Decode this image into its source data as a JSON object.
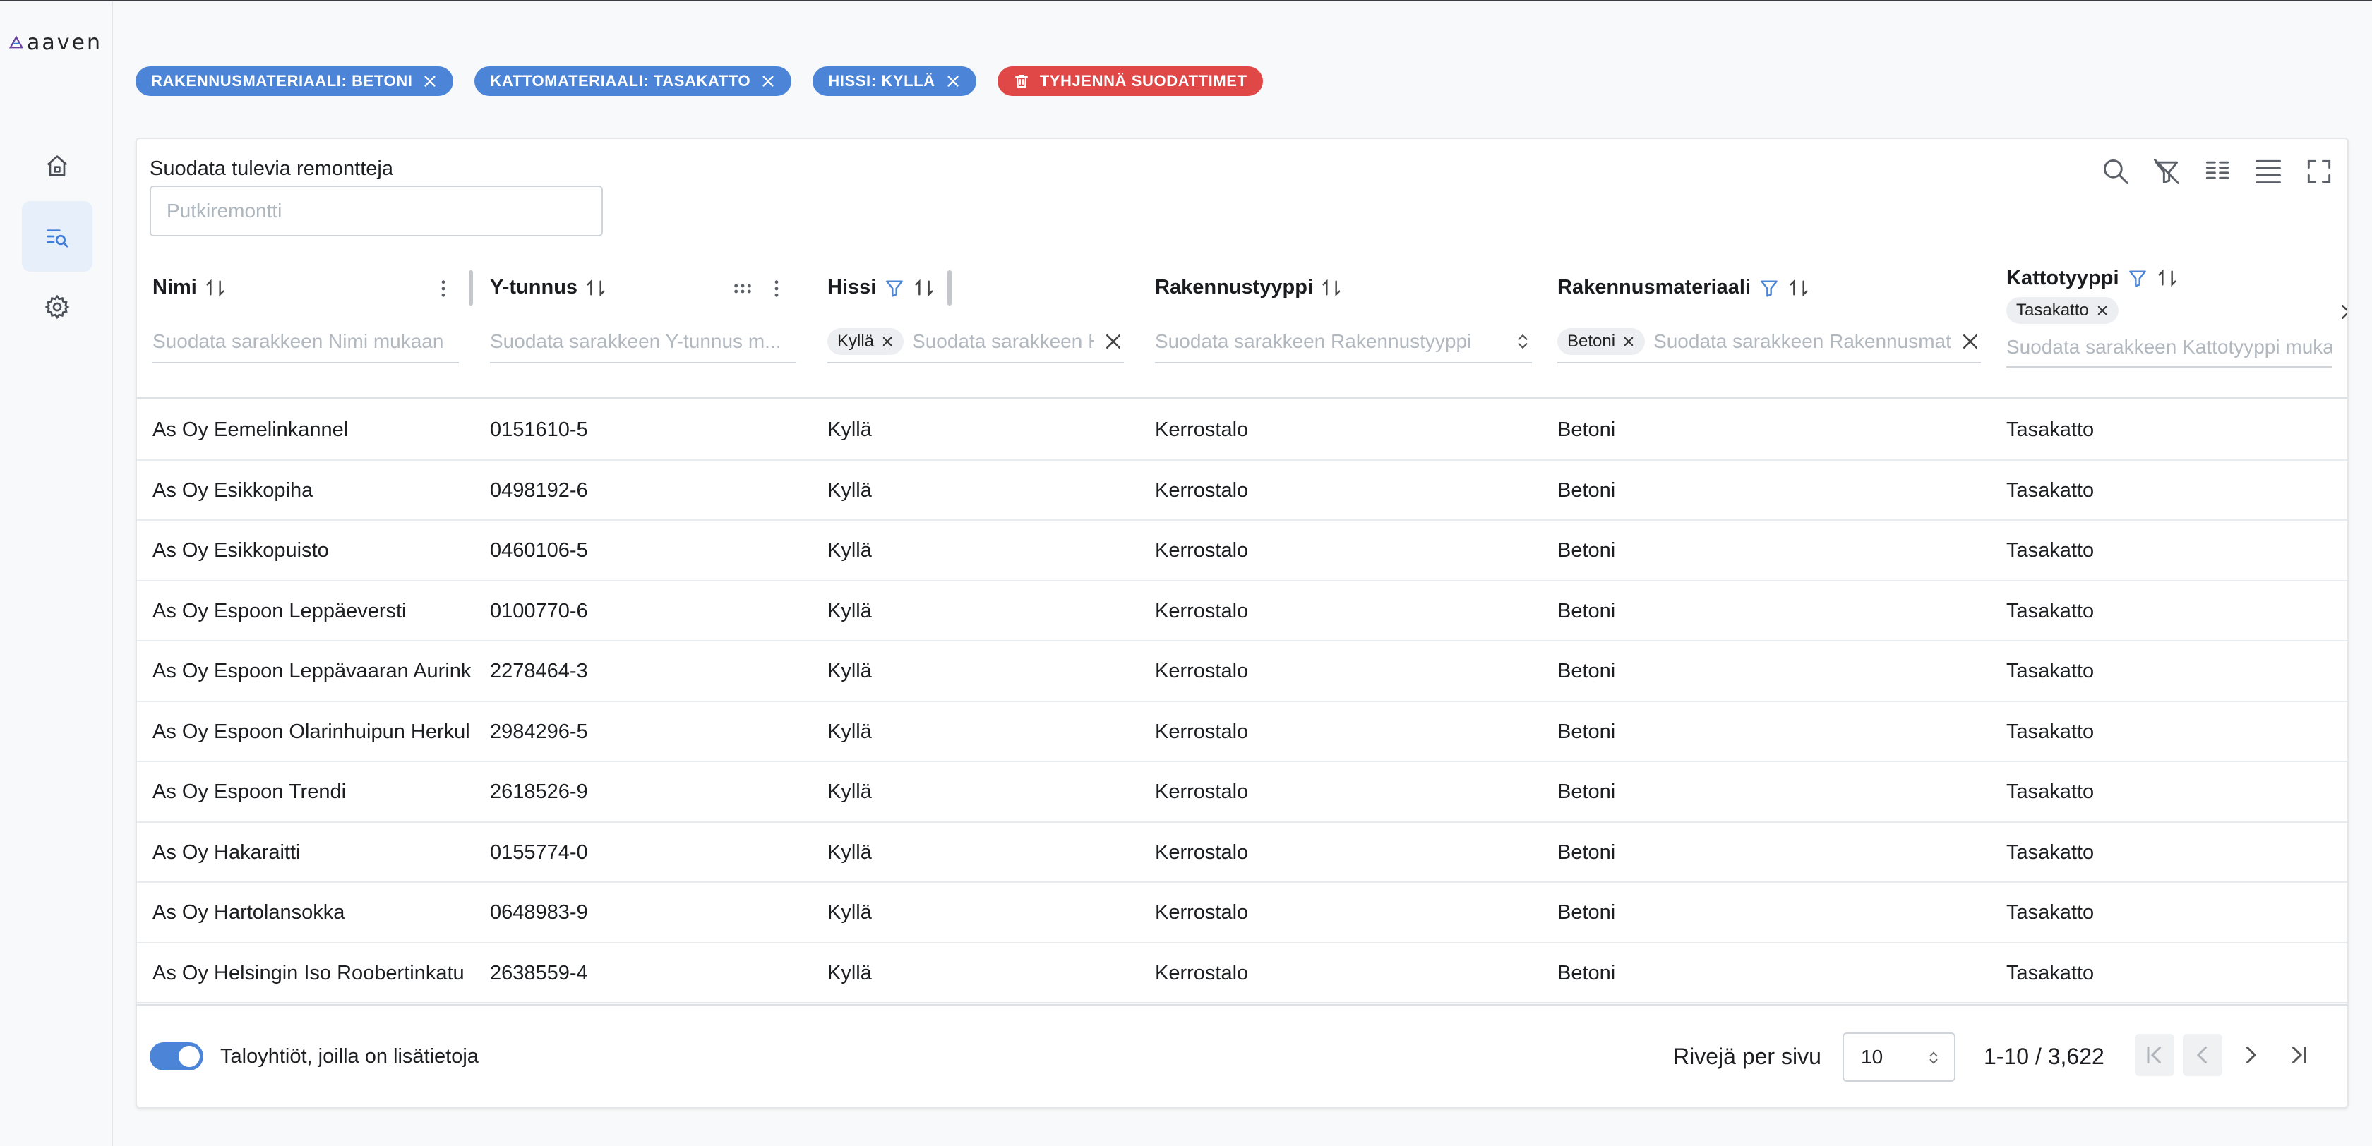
{
  "app": {
    "logo_text": "aaven"
  },
  "sidebar": {
    "items": [
      {
        "icon": "home-icon"
      },
      {
        "icon": "search-list-icon",
        "active": true
      },
      {
        "icon": "gear-icon"
      }
    ]
  },
  "active_filters": {
    "chips": [
      {
        "label": "RAKENNUSMATERIAALI: BETONI"
      },
      {
        "label": "KATTOMATERIAALI: TASAKATTO"
      },
      {
        "label": "HISSI: KYLLÄ"
      }
    ],
    "clear_label": "TYHJENNÄ SUODATTIMET"
  },
  "table": {
    "global_filter": {
      "label": "Suodata tulevia remontteja",
      "placeholder": "Putkiremontti",
      "value": ""
    },
    "columns": [
      {
        "key": "nimi",
        "title": "Nimi",
        "filter_placeholder": "Suodata sarakkeen Nimi mukaan"
      },
      {
        "key": "ytunnus",
        "title": "Y-tunnus",
        "filter_placeholder": "Suodata sarakkeen Y-tunnus m..."
      },
      {
        "key": "hissi",
        "title": "Hissi",
        "filter_chip": "Kyllä",
        "filter_placeholder": "Suodata sarakkeen Hissi mukaan"
      },
      {
        "key": "rakennustyyppi",
        "title": "Rakennustyyppi",
        "filter_placeholder": "Suodata sarakkeen Rakennustyyppi"
      },
      {
        "key": "rakennusmateriaali",
        "title": "Rakennusmateriaali",
        "filter_chip": "Betoni",
        "filter_placeholder": "Suodata sarakkeen Rakennusmateriaali mukaan"
      },
      {
        "key": "kattotyyppi",
        "title": "Kattotyyppi",
        "filter_chip": "Tasakatto",
        "filter_placeholder": "Suodata sarakkeen Kattotyyppi mukaan"
      }
    ],
    "rows": [
      [
        "As Oy Eemelinkannel",
        "0151610-5",
        "Kyllä",
        "Kerrostalo",
        "Betoni",
        "Tasakatto"
      ],
      [
        "As Oy Esikkopiha",
        "0498192-6",
        "Kyllä",
        "Kerrostalo",
        "Betoni",
        "Tasakatto"
      ],
      [
        "As Oy Esikkopuisto",
        "0460106-5",
        "Kyllä",
        "Kerrostalo",
        "Betoni",
        "Tasakatto"
      ],
      [
        "As Oy Espoon Leppäeversti",
        "0100770-6",
        "Kyllä",
        "Kerrostalo",
        "Betoni",
        "Tasakatto"
      ],
      [
        "As Oy Espoon Leppävaaran Aurink",
        "2278464-3",
        "Kyllä",
        "Kerrostalo",
        "Betoni",
        "Tasakatto"
      ],
      [
        "As Oy Espoon Olarinhuipun Herkul",
        "2984296-5",
        "Kyllä",
        "Kerrostalo",
        "Betoni",
        "Tasakatto"
      ],
      [
        "As Oy Espoon Trendi",
        "2618526-9",
        "Kyllä",
        "Kerrostalo",
        "Betoni",
        "Tasakatto"
      ],
      [
        "As Oy Hakaraitti",
        "0155774-0",
        "Kyllä",
        "Kerrostalo",
        "Betoni",
        "Tasakatto"
      ],
      [
        "As Oy Hartolansokka",
        "0648983-9",
        "Kyllä",
        "Kerrostalo",
        "Betoni",
        "Tasakatto"
      ],
      [
        "As Oy Helsingin Iso Roobertinkatu",
        "2638559-4",
        "Kyllä",
        "Kerrostalo",
        "Betoni",
        "Tasakatto"
      ]
    ],
    "footer": {
      "toggle_label": "Taloyhtiöt, joilla on lisätietoja",
      "toggle_on": true,
      "rows_per_page_label": "Rivejä per sivu",
      "rows_per_page_value": "10",
      "range_text": "1-10 / 3,622"
    }
  },
  "colors": {
    "accent": "#4c85d8",
    "danger": "#e04848",
    "nav_active_bg": "#e7effb"
  }
}
